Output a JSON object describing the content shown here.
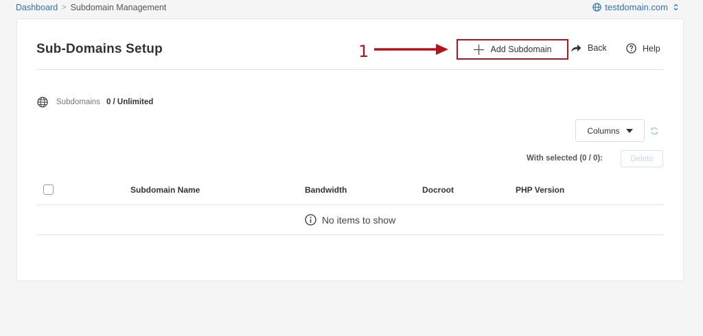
{
  "breadcrumb": {
    "home": "Dashboard",
    "separator": ">",
    "current": "Subdomain Management"
  },
  "domain_selector": {
    "value": "testdomain.com",
    "icon": "globe-icon"
  },
  "page": {
    "title": "Sub-Domains Setup"
  },
  "annotation": {
    "number": "1",
    "color": "#b5121b"
  },
  "toolbar": {
    "add_label": "Add Subdomain",
    "back_label": "Back",
    "help_label": "Help"
  },
  "usage": {
    "label": "Subdomains",
    "value": "0 / Unlimited"
  },
  "table_controls": {
    "columns_label": "Columns",
    "with_selected": "With selected (0 / 0):",
    "delete_label": "Delete"
  },
  "table": {
    "columns": [
      "Subdomain Name",
      "Bandwidth",
      "Docroot",
      "PHP Version"
    ],
    "empty_message": "No items to show"
  },
  "colors": {
    "link": "#2f72b6",
    "annotation_red": "#b5121b",
    "disabled_button": "#c7d9ec"
  }
}
